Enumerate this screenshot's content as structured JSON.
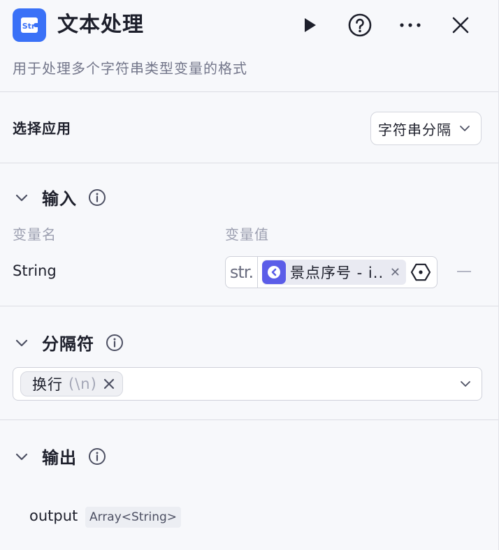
{
  "header": {
    "logo_text": "Str",
    "title": "文本处理",
    "description": "用于处理多个字符串类型变量的格式"
  },
  "app_select": {
    "label": "选择应用",
    "value": "字符串分隔"
  },
  "input": {
    "title": "输入",
    "col_name": "变量名",
    "col_value": "变量值",
    "variable_name": "String",
    "type_tag": "str.",
    "reference": "景点序号 - i.."
  },
  "separator": {
    "title": "分隔符",
    "tag_label": "换行",
    "tag_sub": "(\\n)"
  },
  "output": {
    "title": "输出",
    "name": "output",
    "type": "Array<String>"
  },
  "colors": {
    "accent": "#3a71f7",
    "ref_icon": "#5b5de8"
  }
}
